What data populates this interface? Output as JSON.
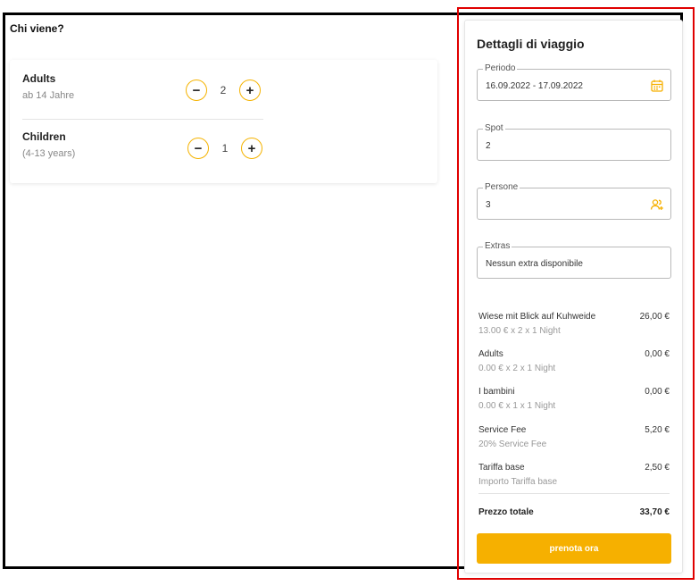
{
  "guests": {
    "title": "Chi viene?",
    "rows": [
      {
        "name": "Adults",
        "sub": "ab 14 Jahre",
        "count": "2",
        "minus": "−",
        "plus": "+"
      },
      {
        "name": "Children",
        "sub": "(4-13 years)",
        "count": "1",
        "minus": "−",
        "plus": "+"
      }
    ]
  },
  "details": {
    "title": "Dettagli di viaggio",
    "fields": [
      {
        "label": "Periodo",
        "value": "16.09.2022 - 17.09.2022",
        "icon": "calendar-icon"
      },
      {
        "label": "Spot",
        "value": "2"
      },
      {
        "label": "Persone",
        "value": "3",
        "icon": "people-icon"
      },
      {
        "label": "Extras",
        "value": "Nessun extra disponibile"
      }
    ],
    "items": [
      {
        "name": "Wiese mit Blick auf Kuhweide",
        "sub": "13.00 € x 2 x 1 Night",
        "price": "26,00 €"
      },
      {
        "name": "Adults",
        "sub": "0.00 € x 2 x 1 Night",
        "price": "0,00 €"
      },
      {
        "name": "I bambini",
        "sub": "0.00 € x 1 x 1 Night",
        "price": "0,00 €"
      },
      {
        "name": "Service Fee",
        "sub": "20% Service Fee",
        "price": "5,20 €"
      },
      {
        "name": "Tariffa base",
        "sub": "Importo Tariffa base",
        "price": "2,50 €"
      }
    ],
    "total_label": "Prezzo totale",
    "total_value": "33,70 €",
    "book_label": "prenota ora"
  },
  "colors": {
    "accent": "#f6b000",
    "highlight_frame": "#e00000",
    "outer_frame": "#000000"
  }
}
